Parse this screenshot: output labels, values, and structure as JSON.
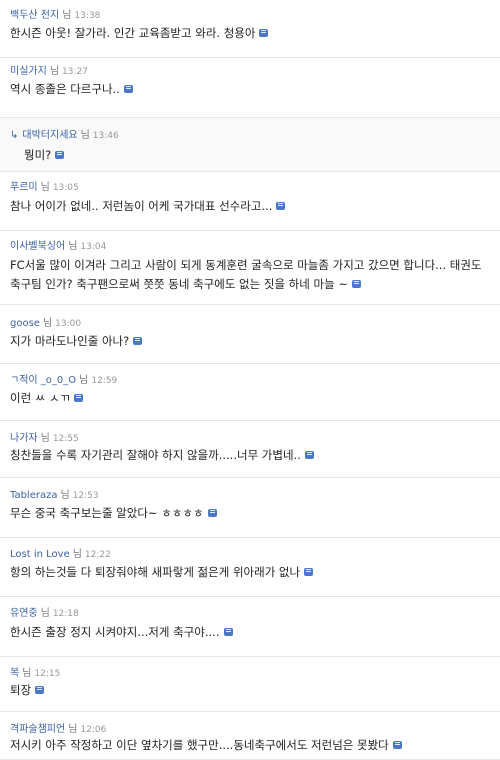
{
  "nim_label": "님",
  "comments": [
    {
      "author": "백두산 천지",
      "time": "13:38",
      "text": "한시즌 아웃! 잘가라. 인간 교육좀받고 와라. 청용아"
    },
    {
      "author": "미실가지",
      "time": "13:27",
      "text": "역시 종졸은 다르구나.."
    },
    {
      "author": "대박터지세요",
      "time": "13:46",
      "text": "뭥미?",
      "reply": true
    },
    {
      "author": "푸르미",
      "time": "13:05",
      "text": "참나 어이가 없네.. 저런놈이 어케 국가대표 선수라고..."
    },
    {
      "author": "이사벨북싱어",
      "time": "13:04",
      "text": "FC서울 많이 이겨라 그리고 사람이 되게 동계훈련 굴속으로 마늘좀 가지고 갔으면 합니다... 태권도 축구팀 인가? 축구팬으로써 쯧쯧 동네 축구에도 없는 짓을 하네 마늘 ~"
    },
    {
      "author": "goose",
      "time": "13:00",
      "text": "지가 마라도나인줄 아나?"
    },
    {
      "author": "ㄱ적이 _o_0_O",
      "time": "12:59",
      "text": "이런 ㅆ ㅅㄲ"
    },
    {
      "author": "나가자",
      "time": "12:55",
      "text": "칭찬들을 수록 자기관리 잘해야 하지 않을까.....너무 가볍네.."
    },
    {
      "author": "Tableraza",
      "time": "12:53",
      "text": "무슨 중국 축구보는줄 알았다~ ㅎㅎㅎㅎ"
    },
    {
      "author": "Lost in Love",
      "time": "12:22",
      "text": "항의 하는것들 다 퇴장줘야해 새파랗게 젊은게 위아래가 없나"
    },
    {
      "author": "유연중",
      "time": "12:18",
      "text": "한시즌 출장 정지 시켜야지...저게 축구야...."
    },
    {
      "author": "복",
      "time": "12:15",
      "text": "퇴장"
    },
    {
      "author": "격파술챔피언",
      "time": "12:06",
      "text": "저시키 아주 작정하고 이단 옆차기를 했구만....동네축구에서도 저런넘은 못봤다"
    }
  ]
}
